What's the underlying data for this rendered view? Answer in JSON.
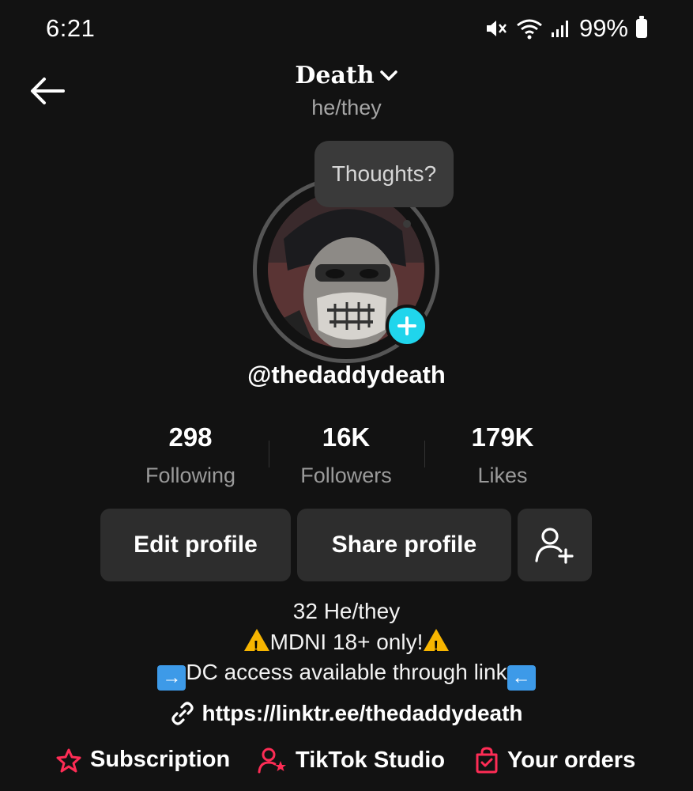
{
  "status_bar": {
    "time": "6:21",
    "battery_percent": "99%",
    "icons": [
      "mute-icon",
      "wifi-icon",
      "signal-icon",
      "battery-icon"
    ]
  },
  "header": {
    "title": "Death",
    "pronouns": "he/they"
  },
  "note_bubble": "Thoughts?",
  "profile": {
    "username": "@thedaddydeath"
  },
  "stats": [
    {
      "value": "298",
      "label": "Following"
    },
    {
      "value": "16K",
      "label": "Followers"
    },
    {
      "value": "179K",
      "label": "Likes"
    }
  ],
  "buttons": {
    "edit": "Edit profile",
    "share": "Share profile"
  },
  "bio": {
    "line1": "32 He/they",
    "line2": "MDNI 18+ only!",
    "line3": "DC access available through link"
  },
  "link": "https://linktr.ee/thedaddydeath",
  "bottom_actions": [
    {
      "label": "Subscription",
      "icon": "subscription-icon"
    },
    {
      "label": "TikTok Studio",
      "icon": "studio-icon"
    },
    {
      "label": "Your orders",
      "icon": "orders-icon"
    }
  ],
  "colors": {
    "background": "#121212",
    "accent_cyan": "#20d5ec",
    "accent_red": "#fe2c55",
    "button_bg": "#2d2d2d"
  }
}
